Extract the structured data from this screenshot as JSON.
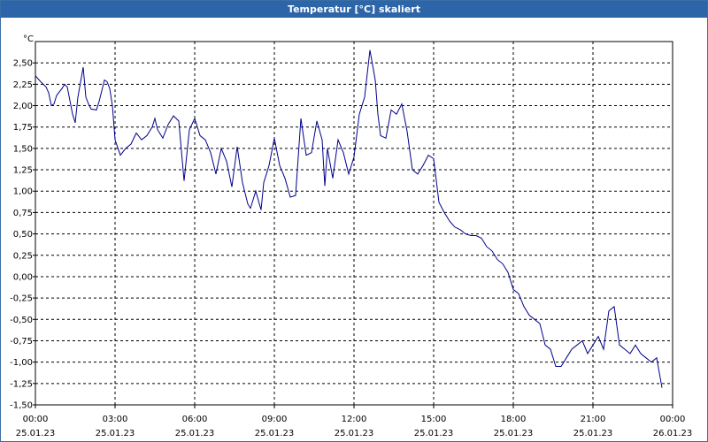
{
  "window": {
    "title": "Temperatur [°C] skaliert"
  },
  "chart_data": {
    "type": "line",
    "title": "Temperatur [°C] skaliert",
    "ylabel": "°C",
    "xlabel": "",
    "ylim": [
      -1.5,
      2.75
    ],
    "grid": true,
    "y_ticks": [
      "2,50",
      "2,25",
      "2,00",
      "1,75",
      "1,50",
      "1,25",
      "1,00",
      "0,75",
      "0,50",
      "0,25",
      "0,00",
      "-0,25",
      "-0,50",
      "-0,75",
      "-1,00",
      "-1,25",
      "-1,50"
    ],
    "x_ticks": [
      {
        "time": "00:00",
        "date": "25.01.23"
      },
      {
        "time": "03:00",
        "date": "25.01.23"
      },
      {
        "time": "06:00",
        "date": "25.01.23"
      },
      {
        "time": "09:00",
        "date": "25.01.23"
      },
      {
        "time": "12:00",
        "date": "25.01.23"
      },
      {
        "time": "15:00",
        "date": "25.01.23"
      },
      {
        "time": "18:00",
        "date": "25.01.23"
      },
      {
        "time": "21:00",
        "date": "25.01.23"
      },
      {
        "time": "00:00",
        "date": "26.01.23"
      }
    ],
    "colors": {
      "line": "#00008b",
      "grid": "#000000",
      "title_bar": "#2c65a8"
    },
    "series": [
      {
        "x_hours": [
          0,
          0.2,
          0.4,
          0.5,
          0.6,
          0.7,
          0.8,
          1.0,
          1.1,
          1.2,
          1.4,
          1.5,
          1.6,
          1.8,
          1.9,
          2.0,
          2.1,
          2.3,
          2.4,
          2.6,
          2.7,
          2.8,
          2.9,
          3.0,
          3.2,
          3.4,
          3.6,
          3.8,
          4.0,
          4.2,
          4.4,
          4.5,
          4.6,
          4.8,
          5.0,
          5.2,
          5.4,
          5.6,
          5.8,
          6.0,
          6.2,
          6.4,
          6.6,
          6.8,
          7.0,
          7.2,
          7.4,
          7.6,
          7.8,
          8.0,
          8.1,
          8.3,
          8.5,
          8.6,
          8.8,
          9.0,
          9.2,
          9.4,
          9.6,
          9.8,
          10.0,
          10.2,
          10.4,
          10.6,
          10.8,
          10.9,
          11.0,
          11.2,
          11.4,
          11.6,
          11.8,
          12.0,
          12.2,
          12.4,
          12.6,
          12.8,
          12.9,
          13.0,
          13.2,
          13.4,
          13.6,
          13.8,
          14.0,
          14.2,
          14.4,
          14.6,
          14.8,
          15.0,
          15.2,
          15.4,
          15.6,
          15.8,
          16.0,
          16.2,
          16.4,
          16.6,
          16.8,
          17.0,
          17.2,
          17.4,
          17.6,
          17.8,
          18.0,
          18.2,
          18.4,
          18.6,
          18.8,
          19.0,
          19.2,
          19.4,
          19.6,
          19.8,
          20.0,
          20.2,
          20.4,
          20.6,
          20.8,
          21.0,
          21.2,
          21.4,
          21.6,
          21.8,
          22.0,
          22.2,
          22.4,
          22.6,
          22.8,
          23.0,
          23.2,
          23.4,
          23.6,
          23.8,
          24.0
        ],
        "values": [
          2.35,
          2.28,
          2.22,
          2.15,
          2.0,
          2.02,
          2.12,
          2.2,
          2.25,
          2.22,
          1.9,
          1.8,
          2.1,
          2.45,
          2.1,
          2.02,
          1.96,
          1.95,
          2.05,
          2.3,
          2.28,
          2.2,
          2.0,
          1.6,
          1.42,
          1.5,
          1.55,
          1.68,
          1.6,
          1.65,
          1.75,
          1.85,
          1.72,
          1.62,
          1.78,
          1.88,
          1.82,
          1.12,
          1.72,
          1.85,
          1.65,
          1.6,
          1.45,
          1.2,
          1.5,
          1.35,
          1.05,
          1.52,
          1.1,
          0.85,
          0.8,
          1.0,
          0.78,
          1.1,
          1.3,
          1.62,
          1.3,
          1.15,
          0.93,
          0.95,
          1.85,
          1.42,
          1.45,
          1.82,
          1.6,
          1.06,
          1.5,
          1.15,
          1.6,
          1.45,
          1.2,
          1.4,
          1.9,
          2.1,
          2.65,
          2.3,
          1.9,
          1.65,
          1.62,
          1.95,
          1.9,
          2.02,
          1.7,
          1.25,
          1.2,
          1.3,
          1.42,
          1.38,
          0.87,
          0.75,
          0.65,
          0.58,
          0.55,
          0.5,
          0.48,
          0.48,
          0.45,
          0.35,
          0.3,
          0.2,
          0.15,
          0.05,
          -0.15,
          -0.2,
          -0.35,
          -0.45,
          -0.5,
          -0.55,
          -0.8,
          -0.85,
          -1.05,
          -1.05,
          -0.95,
          -0.85,
          -0.8,
          -0.75,
          -0.9,
          -0.8,
          -0.7,
          -0.85,
          -0.4,
          -0.35,
          -0.8,
          -0.85,
          -0.9,
          -0.8,
          -0.9,
          -0.95,
          -1.0,
          -0.95,
          -1.3
        ]
      }
    ]
  }
}
